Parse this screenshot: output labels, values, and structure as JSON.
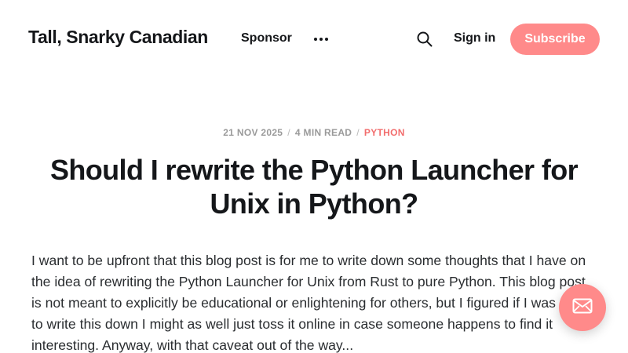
{
  "header": {
    "site_title": "Tall, Snarky Canadian",
    "nav": {
      "sponsor_label": "Sponsor",
      "more_icon": "more-horizontal-icon"
    },
    "search_icon": "search-icon",
    "signin_label": "Sign in",
    "subscribe_label": "Subscribe"
  },
  "article": {
    "date": "21 NOV 2025",
    "read_time": "4 MIN READ",
    "tag": "PYTHON",
    "separator": "/",
    "title": "Should I rewrite the Python Launcher for Unix in Python?",
    "excerpt": "I want to be upfront that this blog post is for me to write down some thoughts that I have on the idea of rewriting the Python Launcher for Unix from Rust to pure Python. This blog post is not meant to explicitly be educational or enlightening for others, but I figured if I was going to write this down I might as well just toss it online in case someone happens to find it interesting. Anyway, with that caveat out of the way..."
  },
  "portal_button": {
    "icon": "mail-icon"
  },
  "colors": {
    "accent": "#ff8a8a",
    "tag": "#f26d6d",
    "text": "#15171a",
    "meta": "#9a9a9a"
  }
}
